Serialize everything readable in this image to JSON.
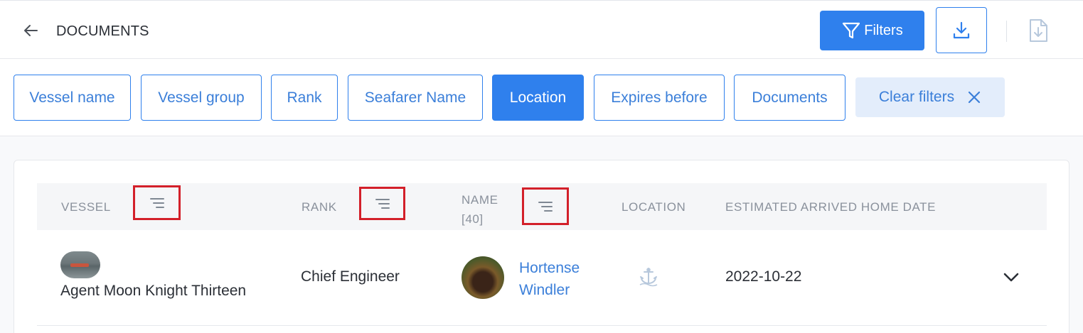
{
  "header": {
    "title": "DOCUMENTS",
    "filters_label": "Filters"
  },
  "chips": [
    {
      "label": "Vessel name",
      "active": false
    },
    {
      "label": "Vessel group",
      "active": false
    },
    {
      "label": "Rank",
      "active": false
    },
    {
      "label": "Seafarer Name",
      "active": false
    },
    {
      "label": "Location",
      "active": true
    },
    {
      "label": "Expires before",
      "active": false
    },
    {
      "label": "Documents",
      "active": false
    }
  ],
  "clear_filters_label": "Clear filters",
  "table": {
    "columns": {
      "vessel": "VESSEL",
      "rank": "RANK",
      "name": "NAME",
      "name_count": "[40]",
      "location": "LOCATION",
      "est_home": "ESTIMATED ARRIVED HOME DATE"
    },
    "rows": [
      {
        "vessel": "Agent Moon Knight Thirteen",
        "rank": "Chief Engineer",
        "name_first": "Hortense",
        "name_last": "Windler",
        "est_home": "2022-10-22"
      }
    ]
  },
  "colors": {
    "accent": "#2f80ed",
    "highlight_box": "#d3202a"
  }
}
